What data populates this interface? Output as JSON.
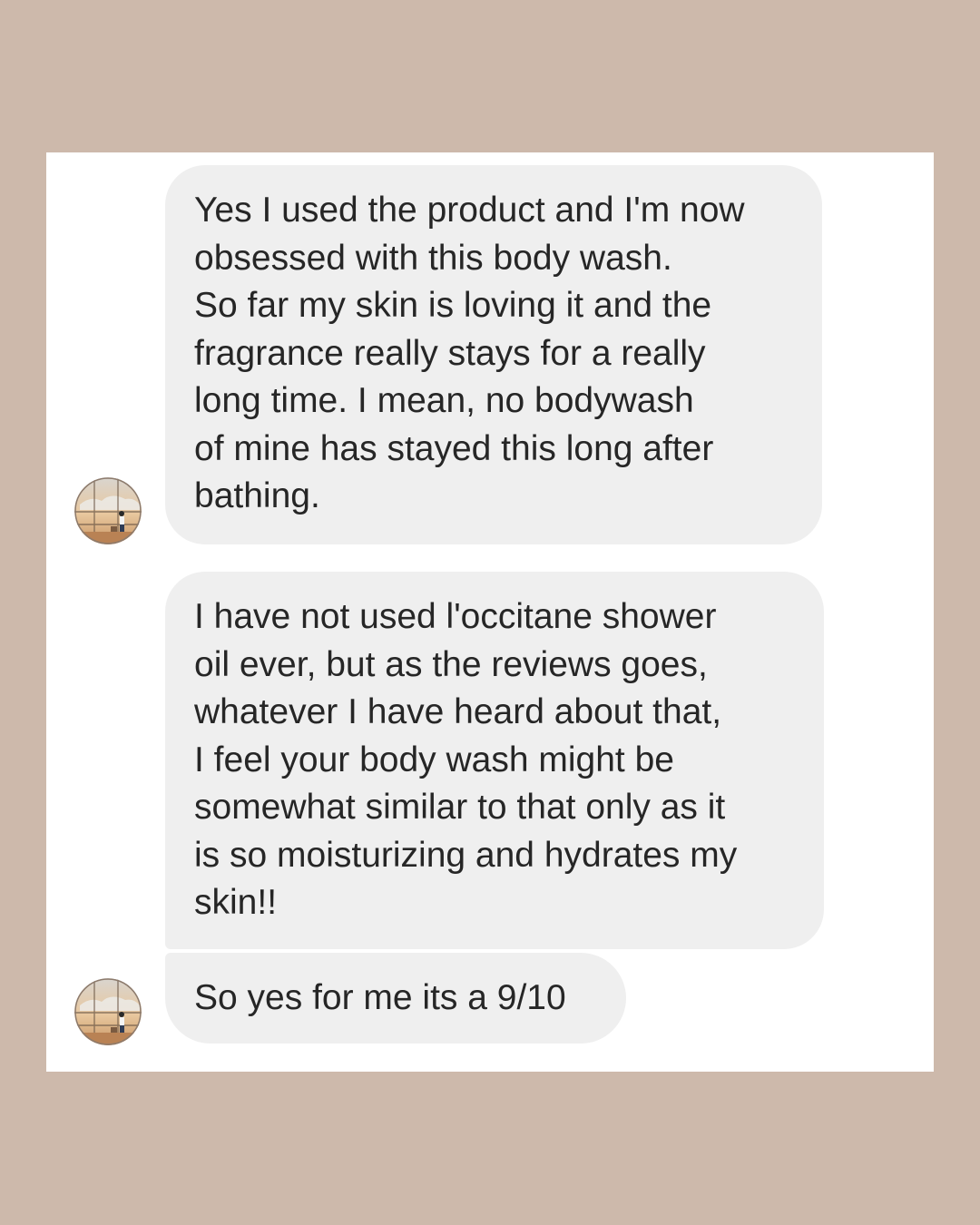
{
  "thread": {
    "messages": [
      {
        "lines": [
          "Yes I used the product and I'm now",
          "obsessed with this body wash.",
          "So far my skin is loving it and the",
          "fragrance really stays for a really",
          "long time. I mean, no bodywash",
          "of mine has stayed this long after",
          "bathing."
        ]
      },
      {
        "lines": [
          "I have not used l'occitane shower",
          "oil ever, but as the reviews goes,",
          "whatever I have heard about that,",
          "I feel your body wash might be",
          "somewhat similar to that only as it",
          "is so moisturizing and hydrates my",
          "skin!!"
        ]
      },
      {
        "lines": [
          "So yes for me its a 9/10"
        ]
      }
    ],
    "avatar_icon": "sender-avatar-illustration-icon"
  },
  "colors": {
    "page_background": "#cdb9ab",
    "card_background": "#ffffff",
    "bubble_background": "#efefef",
    "text": "#262626"
  }
}
